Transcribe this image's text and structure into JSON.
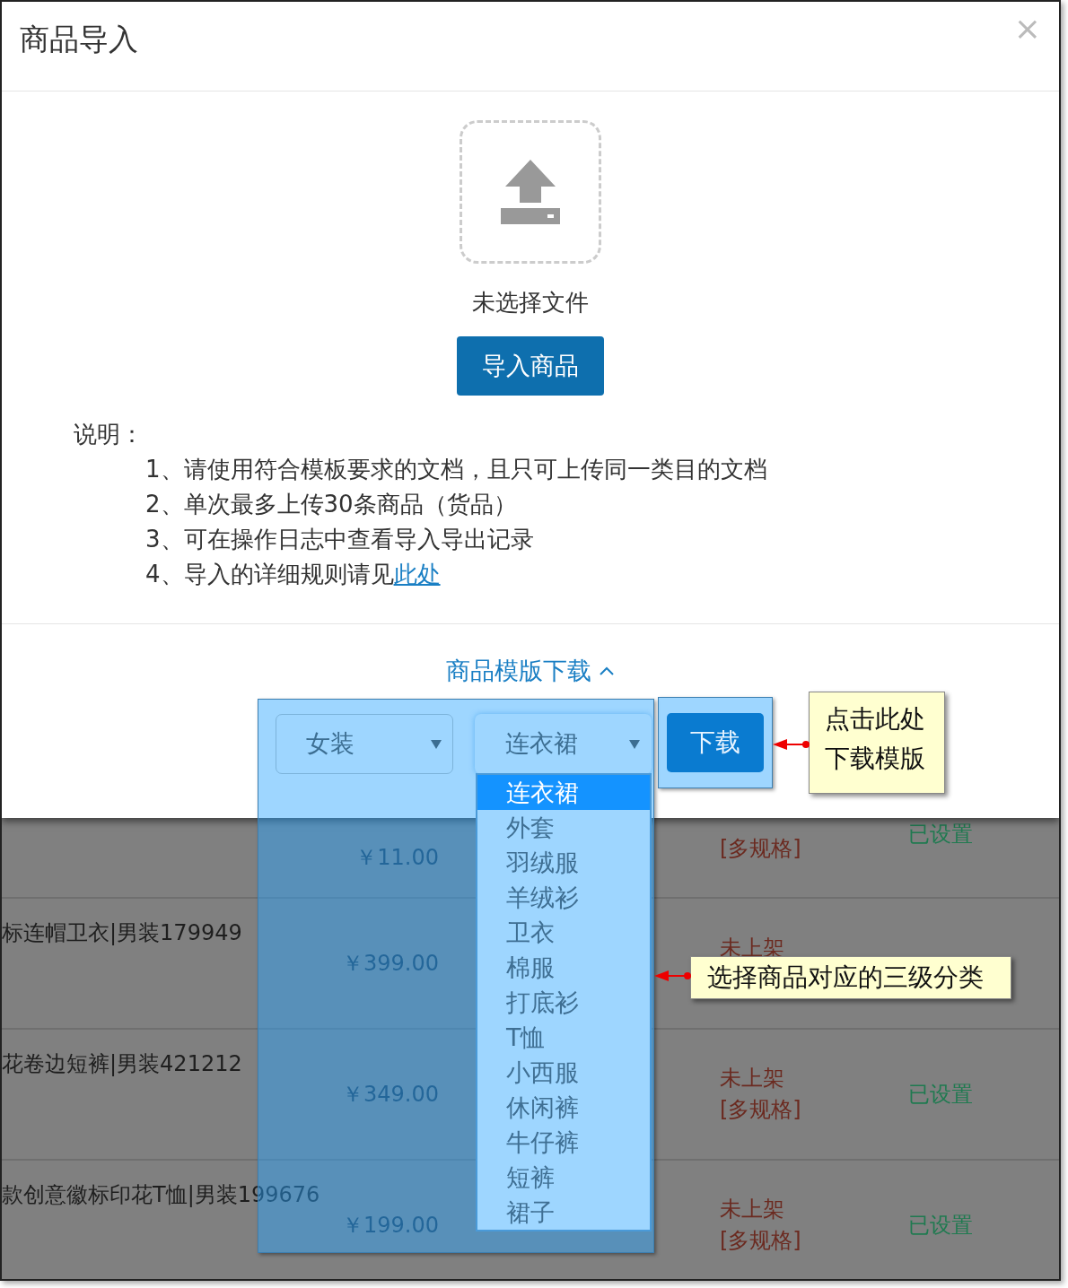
{
  "dialog": {
    "title": "商品导入",
    "close": "×",
    "upload": {
      "status": "未选择文件"
    },
    "import_button": "导入商品",
    "notes": {
      "heading": "说明：",
      "items": [
        {
          "text": "1、请使用符合模板要求的文档，且只可上传同一类目的文档"
        },
        {
          "text": "2、单次最多上传30条商品（货品）"
        },
        {
          "text": "3、可在操作日志中查看导入导出记录"
        },
        {
          "text": "4、导入的详细规则请见",
          "link": "此处"
        }
      ]
    },
    "template_toggle": {
      "label": "商品模版下载",
      "expanded": true
    }
  },
  "template_form": {
    "category_select": {
      "value": "女装"
    },
    "subcategory_select": {
      "value": "连衣裙",
      "expanded": true,
      "options": [
        {
          "label": "连衣裙",
          "selected": true
        },
        {
          "label": "外套",
          "selected": false
        },
        {
          "label": "羽绒服",
          "selected": false
        },
        {
          "label": "羊绒衫",
          "selected": false
        },
        {
          "label": "卫衣",
          "selected": false
        },
        {
          "label": "棉服",
          "selected": false
        },
        {
          "label": "打底衫",
          "selected": false
        },
        {
          "label": "T恤",
          "selected": false
        },
        {
          "label": "小西服",
          "selected": false
        },
        {
          "label": "休闲裤",
          "selected": false
        },
        {
          "label": "牛仔裤",
          "selected": false
        },
        {
          "label": "短裤",
          "selected": false
        },
        {
          "label": "裙子",
          "selected": false
        }
      ]
    },
    "download_button": "下载"
  },
  "table": {
    "rows": [
      {
        "price": "￥11.00",
        "spec_note": "[多规格]",
        "setting": "已设置"
      },
      {
        "name": "标连帽卫衣|男装179949",
        "price": "￥399.00",
        "status": "未上架"
      },
      {
        "name": "花卷边短裤|男装421212",
        "price": "￥349.00",
        "status": "未上架",
        "spec_note": "[多规格]",
        "setting": "已设置"
      },
      {
        "name": "款创意徽标印花T恤|男装199676",
        "price": "￥199.00",
        "status": "未上架",
        "spec_note": "[多规格]",
        "setting": "已设置"
      }
    ]
  },
  "callouts": [
    {
      "text": "点击此处下载模版"
    },
    {
      "text": "选择商品对应的三级分类"
    }
  ]
}
